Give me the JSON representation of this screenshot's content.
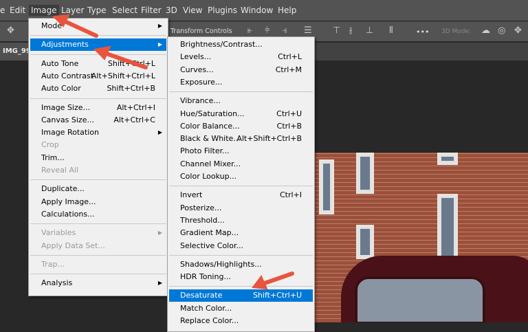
{
  "menubar": [
    "e",
    "Edit",
    "Image",
    "Layer",
    "Type",
    "Select",
    "Filter",
    "3D",
    "View",
    "Plugins",
    "Window",
    "Help"
  ],
  "options": {
    "transform_controls": "Transform Controls",
    "more": "•••",
    "mode3d": "3D Mode:"
  },
  "document_tab": "IMG_99",
  "image_menu": [
    {
      "label": "Mode",
      "sub": true
    },
    {
      "sep": true
    },
    {
      "label": "Adjustments",
      "sub": true,
      "hl": true
    },
    {
      "sep": true
    },
    {
      "label": "Auto Tone",
      "sc": "Shift+Ctrl+L"
    },
    {
      "label": "Auto Contrast",
      "sc": "Alt+Shift+Ctrl+L"
    },
    {
      "label": "Auto Color",
      "sc": "Shift+Ctrl+B"
    },
    {
      "sep": true
    },
    {
      "label": "Image Size...",
      "sc": "Alt+Ctrl+I"
    },
    {
      "label": "Canvas Size...",
      "sc": "Alt+Ctrl+C"
    },
    {
      "label": "Image Rotation",
      "sub": true
    },
    {
      "label": "Crop",
      "dis": true
    },
    {
      "label": "Trim..."
    },
    {
      "label": "Reveal All",
      "dis": true
    },
    {
      "sep": true
    },
    {
      "label": "Duplicate..."
    },
    {
      "label": "Apply Image..."
    },
    {
      "label": "Calculations..."
    },
    {
      "sep": true
    },
    {
      "label": "Variables",
      "sub": true,
      "dis": true
    },
    {
      "label": "Apply Data Set...",
      "dis": true
    },
    {
      "sep": true
    },
    {
      "label": "Trap...",
      "dis": true
    },
    {
      "sep": true
    },
    {
      "label": "Analysis",
      "sub": true
    }
  ],
  "adjustments_menu": [
    {
      "label": "Brightness/Contrast..."
    },
    {
      "label": "Levels...",
      "sc": "Ctrl+L"
    },
    {
      "label": "Curves...",
      "sc": "Ctrl+M"
    },
    {
      "label": "Exposure..."
    },
    {
      "sep": true
    },
    {
      "label": "Vibrance..."
    },
    {
      "label": "Hue/Saturation...",
      "sc": "Ctrl+U"
    },
    {
      "label": "Color Balance...",
      "sc": "Ctrl+B"
    },
    {
      "label": "Black & White...",
      "sc": "Alt+Shift+Ctrl+B"
    },
    {
      "label": "Photo Filter..."
    },
    {
      "label": "Channel Mixer..."
    },
    {
      "label": "Color Lookup..."
    },
    {
      "sep": true
    },
    {
      "label": "Invert",
      "sc": "Ctrl+I"
    },
    {
      "label": "Posterize..."
    },
    {
      "label": "Threshold..."
    },
    {
      "label": "Gradient Map..."
    },
    {
      "label": "Selective Color..."
    },
    {
      "sep": true
    },
    {
      "label": "Shadows/Highlights..."
    },
    {
      "label": "HDR Toning..."
    },
    {
      "sep": true
    },
    {
      "label": "Desaturate",
      "sc": "Shift+Ctrl+U",
      "hl": true
    },
    {
      "label": "Match Color..."
    },
    {
      "label": "Replace Color..."
    }
  ],
  "colors": {
    "highlight": "#0078d7",
    "arrow": "#e8553e"
  }
}
